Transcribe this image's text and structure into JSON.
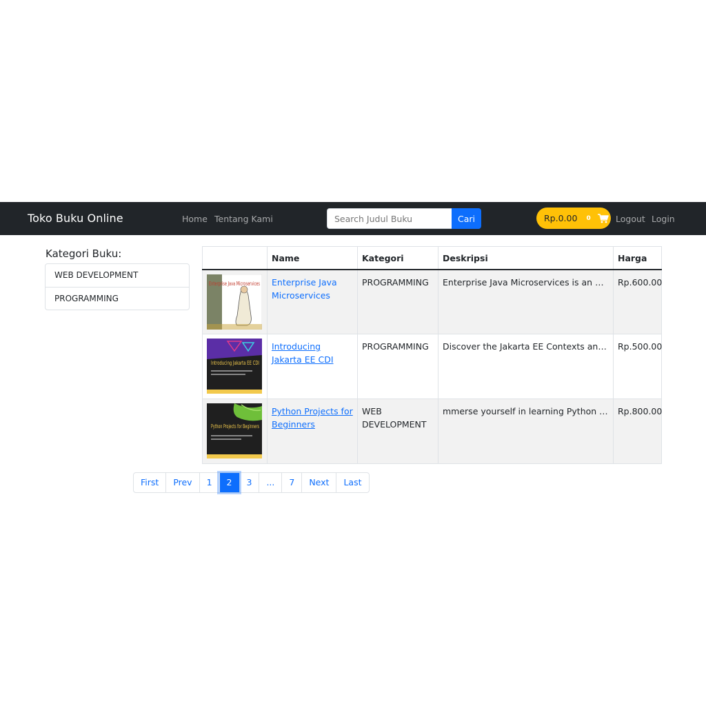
{
  "navbar": {
    "brand": "Toko Buku Online",
    "links": {
      "home": "Home",
      "about": "Tentang Kami"
    },
    "search": {
      "placeholder": "Search Judul Buku",
      "button": "Cari"
    },
    "cart": {
      "total": "Rp.0.00",
      "count": "0",
      "icon": "cart-icon"
    },
    "auth": {
      "logout": "Logout",
      "login": "Login"
    },
    "colors": {
      "background": "#212529",
      "primary": "#0d6efd",
      "cart": "#ffc107"
    }
  },
  "sidebar": {
    "title": "Kategori Buku:",
    "categories": [
      "WEB DEVELOPMENT",
      "PROGRAMMING"
    ]
  },
  "table": {
    "headers": [
      "",
      "Name",
      "Kategori",
      "Deskripsi",
      "Harga"
    ],
    "rows": [
      {
        "cover_title": "Enterprise Java Microservices",
        "name": "Enterprise Java Microservices",
        "category": "PROGRAMMING",
        "description": "Enterprise Java Microservices is an example-rich tutorial",
        "price": "Rp.600.00"
      },
      {
        "cover_title": "Introducing Jakarta EE CDI",
        "name": "Introducing Jakarta EE CDI",
        "category": "PROGRAMMING",
        "description": "Discover the Jakarta EE Contexts and Dependency Injection",
        "price": "Rp.500.00"
      },
      {
        "cover_title": "Python Projects for Beginners",
        "name": "Python Projects for Beginners",
        "category": "WEB DEVELOPMENT",
        "description": "mmerse yourself in learning Python and data analysis",
        "price": "Rp.800.00"
      }
    ]
  },
  "pagination": {
    "items": [
      "First",
      "Prev",
      "1",
      "2",
      "3",
      "...",
      "7",
      "Next",
      "Last"
    ],
    "active": "2"
  }
}
